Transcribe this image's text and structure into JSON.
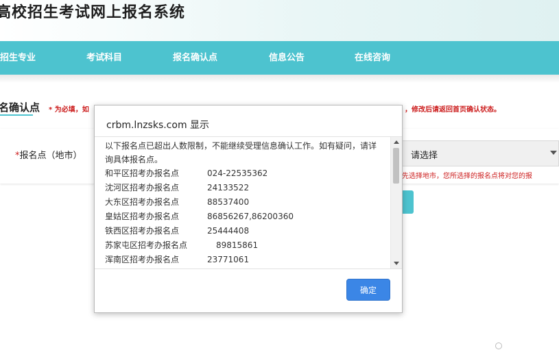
{
  "site": {
    "title": "高校招生考试网上报名系统"
  },
  "nav": {
    "items": [
      {
        "label": "招生专业"
      },
      {
        "label": "考试科目"
      },
      {
        "label": "报名确认点"
      },
      {
        "label": "信息公告"
      },
      {
        "label": "在线咨询"
      }
    ]
  },
  "page": {
    "section_title": "名确认点",
    "note_left": "* 为必填，如",
    "note_right": "，修改后请返回首页确认状态。",
    "field_label": "报名点（地市）",
    "field_required_mark": "*",
    "select_value": "请选择",
    "hint": "先选择地市，您所选择的报名点将对您的报"
  },
  "dialog": {
    "title": "crbm.lnzsks.com 显示",
    "message": "以下报名点已超出人数限制，不能继续受理信息确认工作。如有疑问，请详询具体报名点。",
    "offices": [
      {
        "name": "和平区招考办报名点",
        "phone": "024-22535362"
      },
      {
        "name": "沈河区招考办报名点",
        "phone": "24133522"
      },
      {
        "name": "大东区招考办报名点",
        "phone": "88537400"
      },
      {
        "name": "皇姑区招考办报名点",
        "phone": "86856267,86200360"
      },
      {
        "name": "铁西区招考办报名点",
        "phone": "25444408"
      },
      {
        "name": "苏家屯区招考办报名点",
        "phone": "89815861"
      },
      {
        "name": "浑南区招考办报名点",
        "phone": "23771061"
      }
    ],
    "ok_label": "确定"
  },
  "colors": {
    "nav": "#4dc3cf",
    "primary_button": "#3b86e6",
    "required": "#cc1d1d"
  }
}
